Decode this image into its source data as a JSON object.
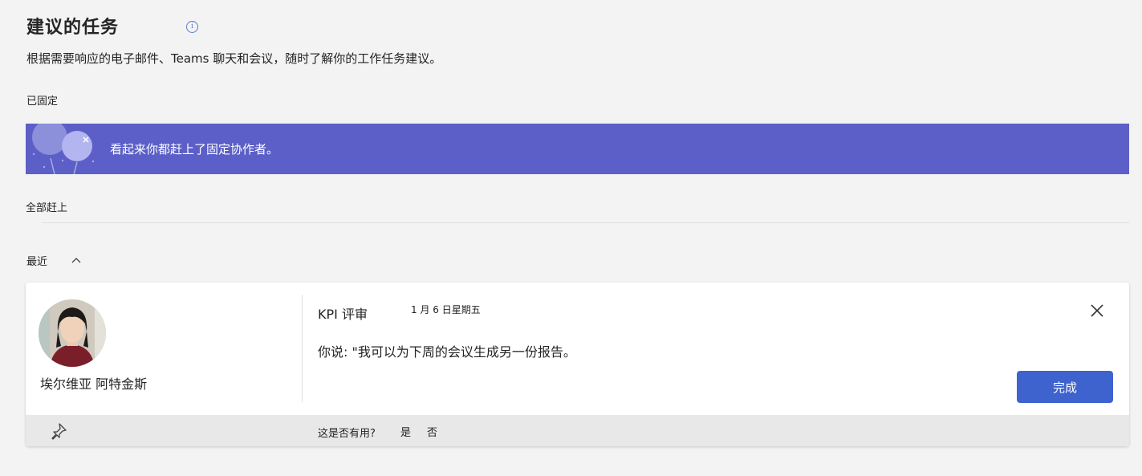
{
  "header": {
    "title": "建议的任务",
    "subtitle": "根据需要响应的电子邮件、Teams 聊天和会议，随时了解你的工作任务建议。"
  },
  "pinned": {
    "label": "已固定",
    "banner_text": "看起来你都赶上了固定协作者。"
  },
  "caught_up": {
    "label": "全部赶上"
  },
  "recent": {
    "label": "最近",
    "card": {
      "person_name": "埃尔维亚 阿特金斯",
      "task_title": "KPI 评审",
      "date": "1 月 6 日星期五",
      "body": "你说: \"我可以为下周的会议生成另一份报告。",
      "done_label": "完成",
      "helpful_question": "这是否有用?",
      "yes_label": "是",
      "no_label": "否"
    }
  },
  "colors": {
    "banner": "#5b5fc7",
    "primary_button": "#3e63cf",
    "info_icon": "#5b7cc9"
  }
}
